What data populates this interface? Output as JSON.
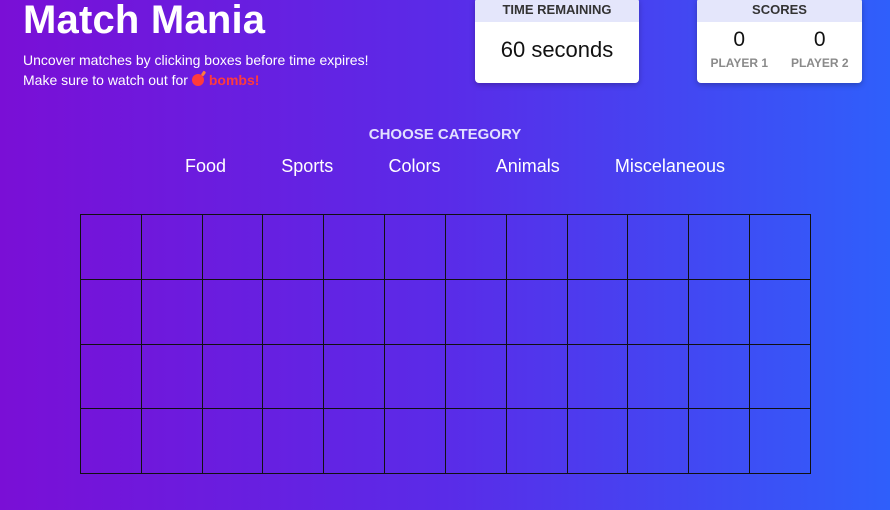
{
  "header": {
    "title": "Match Mania",
    "line1": "Uncover matches by clicking boxes before time expires!",
    "line2_prefix": "Make sure to watch out for ",
    "bomb_icon": "bomb-icon",
    "line2_emphasis": "bombs!",
    "bomb_color": "#ff3b3b"
  },
  "timer": {
    "heading": "TIME REMAINING",
    "value": "60 seconds"
  },
  "scores": {
    "heading": "SCORES",
    "players": [
      {
        "label": "PLAYER 1",
        "score": "0"
      },
      {
        "label": "PLAYER 2",
        "score": "0"
      }
    ]
  },
  "categories": {
    "heading": "CHOOSE CATEGORY",
    "items": [
      "Food",
      "Sports",
      "Colors",
      "Animals",
      "Miscelaneous"
    ]
  },
  "board": {
    "rows": 4,
    "cols": 12
  },
  "colors": {
    "gradient_start": "#7a0fd6",
    "gradient_end": "#2f5ffb",
    "card_header": "#e4e6fb"
  }
}
